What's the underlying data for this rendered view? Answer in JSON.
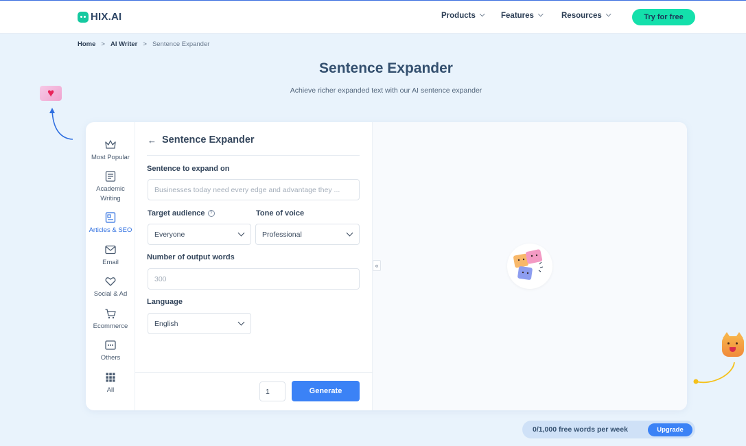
{
  "brand": {
    "name": "HIX.AI"
  },
  "nav": {
    "items": [
      {
        "label": "Products"
      },
      {
        "label": "Features"
      },
      {
        "label": "Resources"
      }
    ],
    "cta": "Try for free"
  },
  "breadcrumb": [
    "Home",
    "AI Writer",
    "Sentence Expander"
  ],
  "page": {
    "title": "Sentence Expander",
    "subtitle": "Achieve richer expanded text with our AI sentence expander"
  },
  "sidebar": {
    "items": [
      {
        "label": "Most Popular",
        "icon": "crown-icon"
      },
      {
        "label": "Academic Writing",
        "icon": "document-icon"
      },
      {
        "label": "Articles & SEO",
        "icon": "article-icon",
        "active": true
      },
      {
        "label": "Email",
        "icon": "mail-icon"
      },
      {
        "label": "Social & Ad",
        "icon": "heart-hand-icon"
      },
      {
        "label": "Ecommerce",
        "icon": "cart-icon"
      },
      {
        "label": "Others",
        "icon": "more-icon"
      },
      {
        "label": "All",
        "icon": "grid-icon"
      }
    ]
  },
  "form": {
    "title": "Sentence Expander",
    "sentence_label": "Sentence to expand on",
    "sentence_placeholder": "Businesses today need every edge and advantage they ...",
    "audience_label": "Target audience",
    "audience_value": "Everyone",
    "tone_label": "Tone of voice",
    "tone_value": "Professional",
    "words_label": "Number of output words",
    "words_placeholder": "300",
    "language_label": "Language",
    "language_value": "English",
    "count_value": "1",
    "generate_label": "Generate"
  },
  "output": {
    "collapse_glyph": "«"
  },
  "quota": {
    "text": "0/1,000 free words per week",
    "upgrade": "Upgrade"
  },
  "colors": {
    "accent": "#3b82f6",
    "cta": "#14e0ab",
    "background": "#e9f3fc"
  }
}
